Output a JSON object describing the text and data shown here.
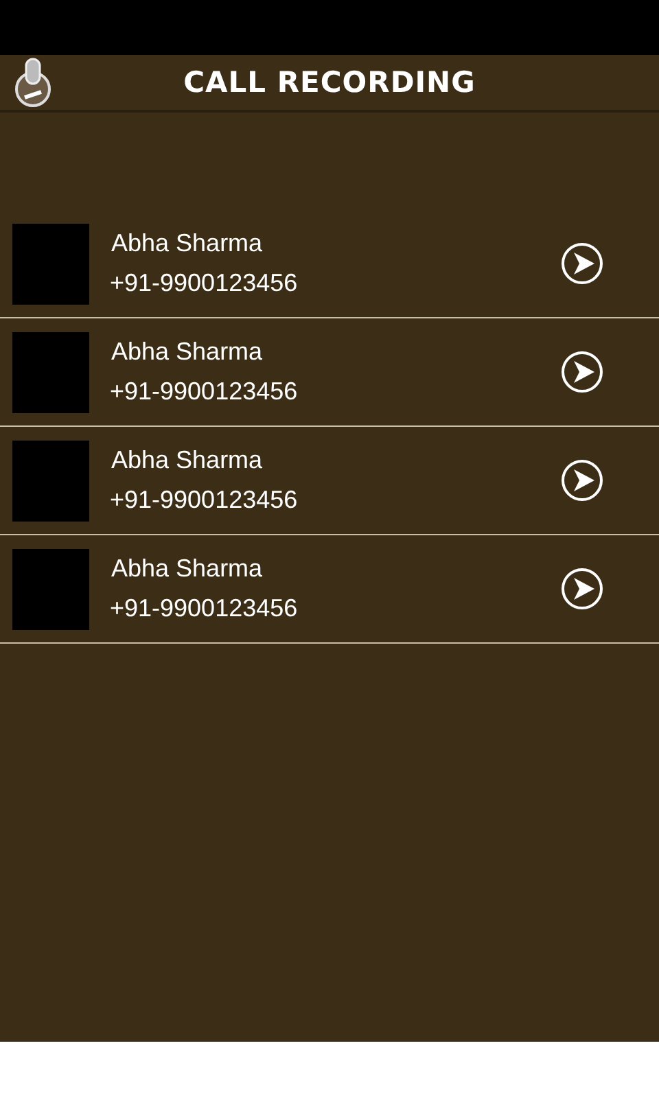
{
  "header": {
    "title": "CALL RECORDING"
  },
  "contacts": [
    {
      "name": "Abha Sharma",
      "phone": "+91-9900123456"
    },
    {
      "name": "Abha Sharma",
      "phone": "+91-9900123456"
    },
    {
      "name": "Abha Sharma",
      "phone": "+91-9900123456"
    },
    {
      "name": "Abha Sharma",
      "phone": "+91-9900123456"
    }
  ]
}
